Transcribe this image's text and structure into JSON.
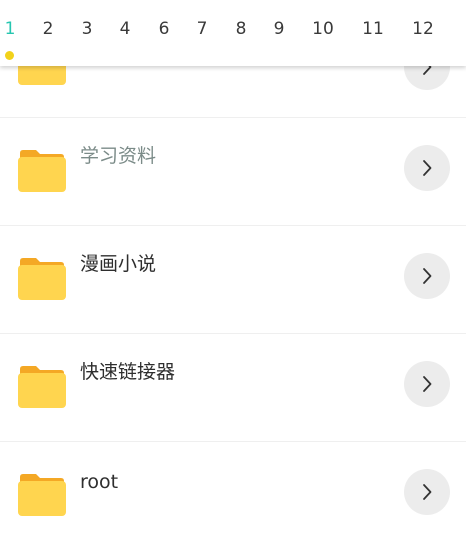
{
  "tabs": [
    "1",
    "2",
    "3",
    "4",
    "6",
    "7",
    "8",
    "9",
    "10",
    "11",
    "12"
  ],
  "active_tab_index": 0,
  "folders": [
    {
      "label": ""
    },
    {
      "label": "学习资料"
    },
    {
      "label": "漫画小说"
    },
    {
      "label": "快速链接器"
    },
    {
      "label": "root"
    }
  ],
  "colors": {
    "folder": "#FFD54F",
    "folder_tab": "#F4A825",
    "active_tab": "#26C6B0",
    "indicator_dot": "#F2D21A",
    "muted_label": "#7B8B88"
  },
  "icons": {
    "folder": "folder-icon",
    "chevron": "chevron-right-icon"
  }
}
